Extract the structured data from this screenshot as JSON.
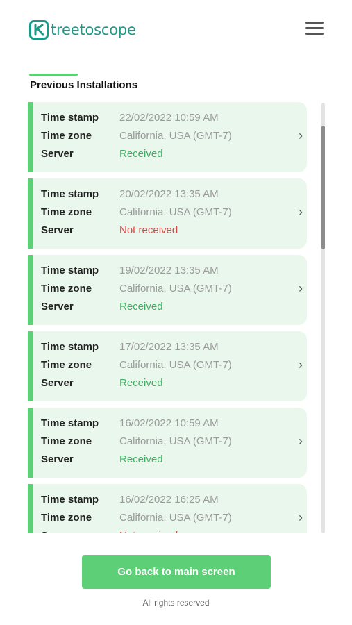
{
  "brand": {
    "name": "treetoscope",
    "color": "#1a9a86"
  },
  "header": {
    "menu_icon": "hamburger-menu-icon"
  },
  "section": {
    "title": "Previous Installations"
  },
  "colors": {
    "accent": "#5ccf77",
    "card_bg": "#eaf7ec",
    "received": "#3fae64",
    "not_received": "#d24a4a"
  },
  "labels": {
    "timestamp": "Time stamp",
    "timezone": "Time zone",
    "server": "Server"
  },
  "installations": [
    {
      "timestamp": "22/02/2022 10:59 AM",
      "timezone": "California, USA (GMT-7)",
      "server": "Received",
      "status": "ok"
    },
    {
      "timestamp": "20/02/2022 13:35 AM",
      "timezone": "California, USA (GMT-7)",
      "server": "Not received",
      "status": "bad"
    },
    {
      "timestamp": "19/02/2022 13:35 AM",
      "timezone": "California, USA (GMT-7)",
      "server": "Received",
      "status": "ok"
    },
    {
      "timestamp": "17/02/2022 13:35 AM",
      "timezone": "California, USA (GMT-7)",
      "server": "Received",
      "status": "ok"
    },
    {
      "timestamp": "16/02/2022 10:59 AM",
      "timezone": "California, USA (GMT-7)",
      "server": "Received",
      "status": "ok"
    },
    {
      "timestamp": "16/02/2022 16:25 AM",
      "timezone": "California, USA (GMT-7)",
      "server": "Not received",
      "status": "bad"
    }
  ],
  "chevron": "›",
  "actions": {
    "back_label": "Go back to main screen"
  },
  "footer": {
    "text": "All rights reserved"
  }
}
